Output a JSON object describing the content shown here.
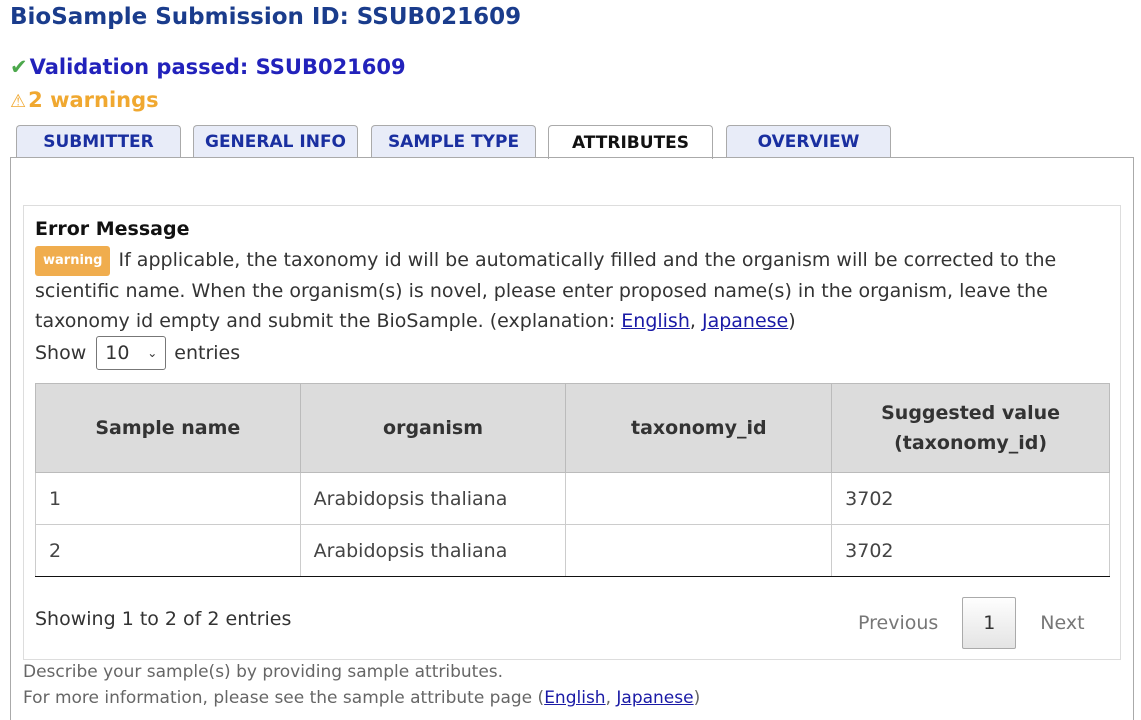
{
  "page": {
    "title": "BioSample Submission ID: SSUB021609",
    "validation": "Validation passed: SSUB021609",
    "warnings": "2 warnings"
  },
  "tabs": [
    {
      "label": "SUBMITTER"
    },
    {
      "label": "GENERAL INFO"
    },
    {
      "label": "SAMPLE TYPE"
    },
    {
      "label": "ATTRIBUTES"
    },
    {
      "label": "OVERVIEW"
    }
  ],
  "error": {
    "title": "Error Message",
    "badge": "warning",
    "message": "If applicable, the taxonomy id will be automatically filled and the organism will be corrected to the scientific name. When the organism(s) is novel, please enter proposed name(s) in the organism, leave the taxonomy id empty and submit the BioSample. (explanation: ",
    "link_english": "English",
    "link_sep": ", ",
    "link_japanese": "Japanese",
    "message_end": ")"
  },
  "length_menu": {
    "prefix": "Show",
    "selected": "10",
    "suffix": "entries"
  },
  "table": {
    "headers": [
      "Sample name",
      "organism",
      "taxonomy_id",
      "Suggested value (taxonomy_id)"
    ],
    "rows": [
      [
        "1",
        "Arabidopsis thaliana",
        "",
        "3702"
      ],
      [
        "2",
        "Arabidopsis thaliana",
        "",
        "3702"
      ]
    ]
  },
  "pagination": {
    "info": "Showing 1 to 2 of 2 entries",
    "previous": "Previous",
    "page": "1",
    "next": "Next"
  },
  "footer": {
    "desc1": "Describe your sample(s) by providing sample attributes.",
    "desc2_prefix": "For more information, please see the sample attribute page (",
    "link_english": "English",
    "link_sep": ", ",
    "link_japanese": "Japanese",
    "desc2_suffix": ")"
  },
  "colors": {
    "title": "#1a3c8c",
    "validation": "#2222bb",
    "check": "#4ca84c",
    "warning": "#f0a830",
    "badge": "#f0ad4e"
  },
  "icons": {
    "check": "check-icon",
    "warning": "warning-triangle-icon",
    "select_chevron": "chevron-down-icon"
  }
}
